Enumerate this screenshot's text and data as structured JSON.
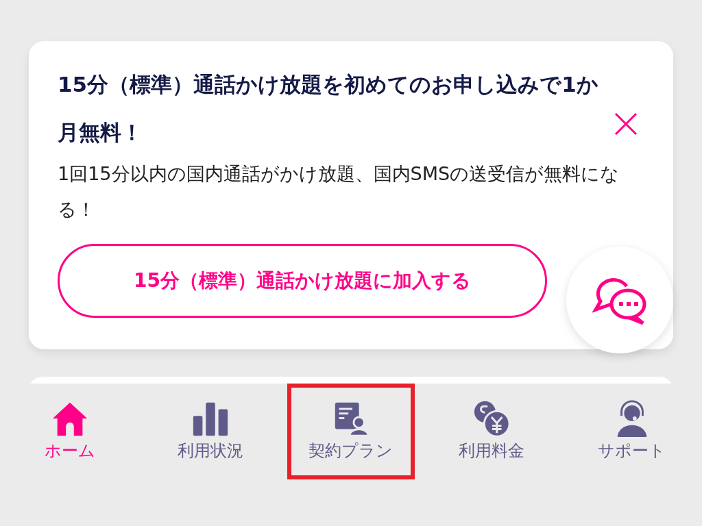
{
  "banner": {
    "title": "15分（標準）通話かけ放題を初めてのお申し込みで1か月無料！",
    "body": "1回15分以内の国内通話がかけ放題、国内SMSの送受信が無料になる！",
    "button": "15分（標準）通話かけ放題に加入する"
  },
  "nav": [
    {
      "label": "ホーム",
      "kind": "home",
      "selected": true,
      "highlighted": false
    },
    {
      "label": "利用状況",
      "kind": "usage",
      "selected": false,
      "highlighted": false
    },
    {
      "label": "契約プラン",
      "kind": "plan",
      "selected": false,
      "highlighted": true
    },
    {
      "label": "利用料金",
      "kind": "fee",
      "selected": false,
      "highlighted": false
    },
    {
      "label": "サポート",
      "kind": "support",
      "selected": false,
      "highlighted": false
    }
  ]
}
